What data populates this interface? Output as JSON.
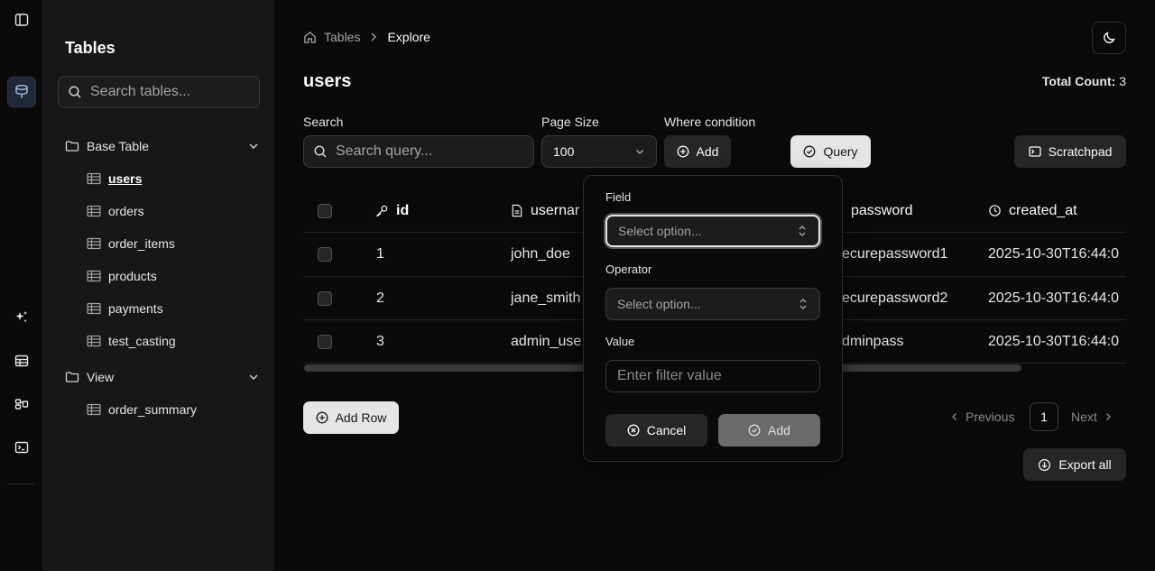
{
  "sidebar": {
    "title": "Tables",
    "search_placeholder": "Search tables...",
    "groups": [
      {
        "label": "Base Table",
        "items": [
          "users",
          "orders",
          "order_items",
          "products",
          "payments",
          "test_casting"
        ]
      },
      {
        "label": "View",
        "items": [
          "order_summary"
        ]
      }
    ]
  },
  "breadcrumb": {
    "home": "Tables",
    "current": "Explore"
  },
  "page": {
    "title": "users",
    "total_label": "Total Count:",
    "total_value": "3"
  },
  "filters": {
    "search_label": "Search",
    "search_placeholder": "Search query...",
    "page_size_label": "Page Size",
    "page_size_value": "100",
    "where_label": "Where condition",
    "add_label": "Add",
    "query_label": "Query",
    "scratchpad_label": "Scratchpad"
  },
  "table": {
    "columns": [
      "id",
      "usernar",
      "password",
      "created_at"
    ],
    "rows": [
      [
        "1",
        "john_doe",
        "ecurepassword1",
        "2025-10-30T16:44:0"
      ],
      [
        "2",
        "jane_smith",
        "ecurepassword2",
        "2025-10-30T16:44:0"
      ],
      [
        "3",
        "admin_use",
        "dminpass",
        "2025-10-30T16:44:0"
      ]
    ]
  },
  "actions": {
    "add_row": "Add Row",
    "export_all": "Export all"
  },
  "pagination": {
    "previous": "Previous",
    "page": "1",
    "next": "Next"
  },
  "popover": {
    "field_label": "Field",
    "field_placeholder": "Select option...",
    "operator_label": "Operator",
    "operator_placeholder": "Select option...",
    "value_label": "Value",
    "value_placeholder": "Enter filter value",
    "cancel": "Cancel",
    "add": "Add"
  },
  "colors": {
    "background": "#0a0a0a",
    "sidebar": "#171717",
    "button": "#262626",
    "button_light": "#e5e5e5"
  }
}
